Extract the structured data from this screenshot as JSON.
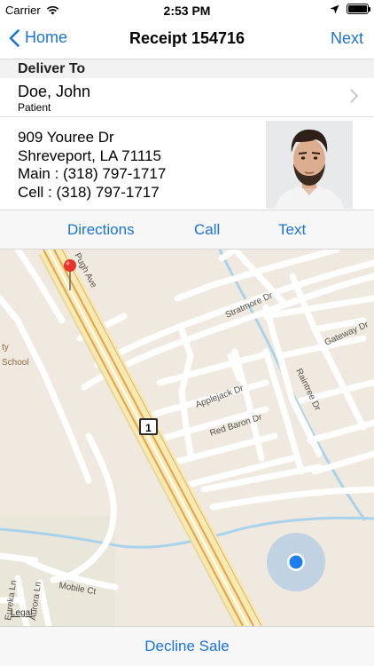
{
  "status_bar": {
    "carrier": "Carrier",
    "time": "2:53 PM"
  },
  "nav": {
    "back_label": "Home",
    "title": "Receipt 154716",
    "next_label": "Next"
  },
  "section": {
    "header": "Deliver To"
  },
  "patient": {
    "name": "Doe, John",
    "role": "Patient"
  },
  "address": {
    "line1": "909 Youree Dr",
    "line2": "Shreveport, LA 71115",
    "main_phone": "Main : (318) 797-1717",
    "cell_phone": "Cell : (318) 797-1717"
  },
  "actions": {
    "directions": "Directions",
    "call": "Call",
    "text": "Text"
  },
  "map": {
    "streets": [
      "Pugh Ave",
      "Stratmore Dr",
      "Gateway Dr",
      "Raintree Dr",
      "Applejack Dr",
      "Red Baron Dr",
      "Mobile Ct",
      "Aurora Ln",
      "Eureka Ln"
    ],
    "school_label": [
      "ty",
      "School"
    ],
    "highway_shield": "1",
    "legal": "Legal"
  },
  "bottom": {
    "decline_label": "Decline Sale"
  },
  "colors": {
    "accent": "#1a73d9",
    "pin": "#e6332a",
    "location": "#1e7ef0"
  }
}
